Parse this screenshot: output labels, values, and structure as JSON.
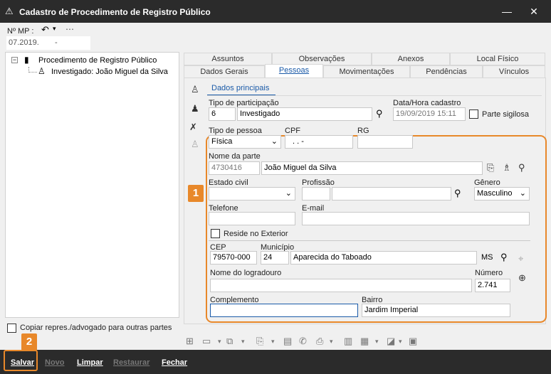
{
  "window": {
    "title": "Cadastro de Procedimento de Registro Público"
  },
  "mp": {
    "label": "Nº MP :",
    "value": "07.2019.",
    "suffix": "-"
  },
  "tree": {
    "root": "Procedimento de Registro Público",
    "child": "Investigado: João Miguel da Silva"
  },
  "copy_checkbox": {
    "label": "Copiar repres./advogado para outras partes",
    "checked": false
  },
  "tabs_row1": [
    "Assuntos",
    "Observações",
    "Anexos",
    "Local Físico"
  ],
  "tabs_row2": [
    "Dados Gerais",
    "Pessoas",
    "Movimentações",
    "Pendências",
    "Vínculos"
  ],
  "active_tab": "Pessoas",
  "subtab": "Dados principais",
  "form": {
    "tipo_participacao_label": "Tipo de participação",
    "tipo_participacao_code": "6",
    "tipo_participacao_value": "Investigado",
    "data_cadastro_label": "Data/Hora cadastro",
    "data_cadastro_value": "19/09/2019 15:11",
    "parte_sigilosa_label": "Parte sigilosa",
    "tipo_pessoa_label": "Tipo de pessoa",
    "tipo_pessoa_value": "Física",
    "cpf_label": "CPF",
    "cpf_value": ".    .    -",
    "rg_label": "RG",
    "rg_value": "",
    "nome_parte_label": "Nome da parte",
    "nome_parte_code": "4730416",
    "nome_parte_value": "João Miguel da Silva",
    "estado_civil_label": "Estado civil",
    "estado_civil_value": "",
    "profissao_label": "Profissão",
    "genero_label": "Gênero",
    "genero_value": "Masculino",
    "telefone_label": "Telefone",
    "email_label": "E-mail",
    "reside_exterior_label": "Reside no Exterior",
    "cep_label": "CEP",
    "cep_value": "79570-000",
    "municipio_label": "Município",
    "municipio_code": "24",
    "municipio_value": "Aparecida do Taboado",
    "uf_value": "MS",
    "logradouro_label": "Nome do logradouro",
    "numero_label": "Número",
    "numero_value": "2.741",
    "complemento_label": "Complemento",
    "complemento_value": "",
    "bairro_label": "Bairro",
    "bairro_value": "Jardim Imperial"
  },
  "buttons": {
    "salvar": "Salvar",
    "novo": "Novo",
    "limpar": "Limpar",
    "restaurar": "Restaurar",
    "fechar": "Fechar"
  },
  "callouts": {
    "one": "1",
    "two": "2"
  },
  "colors": {
    "accent": "#e8882a",
    "active_tab": "#1a5aa8",
    "bar": "#2b2b2b"
  }
}
